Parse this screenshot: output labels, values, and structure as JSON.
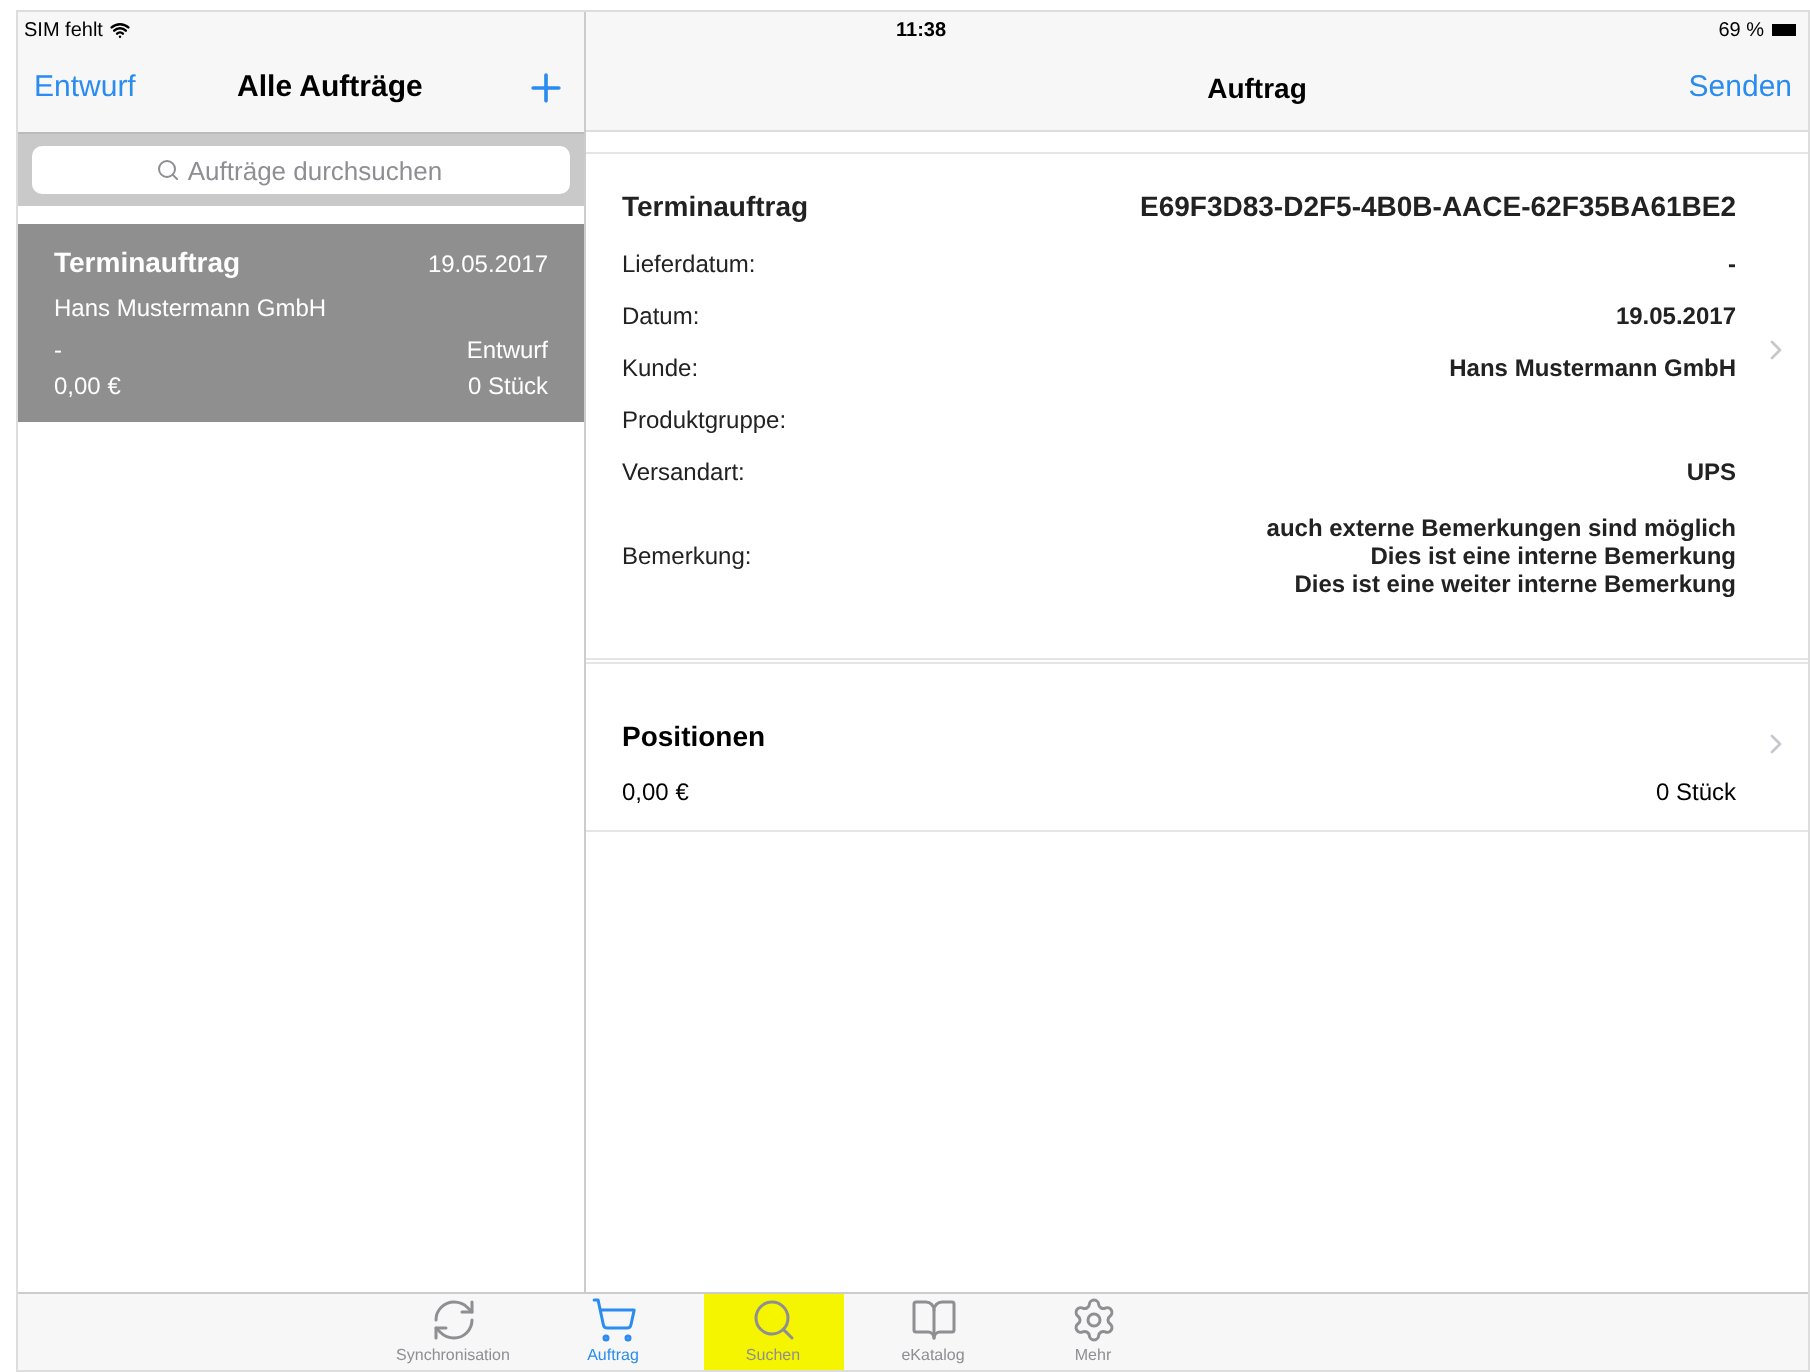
{
  "status_bar": {
    "carrier": "SIM fehlt",
    "time": "11:38",
    "battery": "69 %"
  },
  "master": {
    "nav": {
      "left": "Entwurf",
      "title": "Alle Aufträge"
    },
    "search": {
      "placeholder": "Aufträge durchsuchen"
    },
    "orders": [
      {
        "title": "Terminauftrag",
        "date": "19.05.2017",
        "customer": "Hans Mustermann GmbH",
        "delivery": "-",
        "status": "Entwurf",
        "total": "0,00 €",
        "quantity": "0 Stück",
        "selected": true
      }
    ]
  },
  "detail": {
    "nav": {
      "title": "Auftrag",
      "right": "Senden"
    },
    "header": {
      "type": "Terminauftrag",
      "id": "E69F3D83-D2F5-4B0B-AACE-62F35BA61BE2"
    },
    "fields": [
      {
        "label": "Lieferdatum:",
        "value": [
          "-"
        ]
      },
      {
        "label": "Datum:",
        "value": [
          "19.05.2017"
        ]
      },
      {
        "label": "Kunde:",
        "value": [
          "Hans Mustermann GmbH"
        ]
      },
      {
        "label": "Produktgruppe:"
      },
      {
        "label": "Versandart:",
        "value": [
          "UPS"
        ]
      },
      {
        "label": "Bemerkung:",
        "value": [
          "auch externe Bemerkungen sind möglich",
          "Dies ist eine interne Bemerkung",
          "Dies ist eine weiter interne Bemerkung"
        ]
      }
    ],
    "positions": {
      "title": "Positionen",
      "total": "0,00 €",
      "quantity": "0 Stück"
    }
  },
  "tab_bar": [
    {
      "label": "Synchronisation",
      "kind": "sync",
      "selected": false,
      "highlighted": false
    },
    {
      "label": "Auftrag",
      "kind": "cart",
      "selected": true,
      "highlighted": false
    },
    {
      "label": "Suchen",
      "kind": "search",
      "selected": false,
      "highlighted": true
    },
    {
      "label": "eKatalog",
      "kind": "book",
      "selected": false,
      "highlighted": false
    },
    {
      "label": "Mehr",
      "kind": "gears",
      "selected": false,
      "highlighted": false
    }
  ]
}
